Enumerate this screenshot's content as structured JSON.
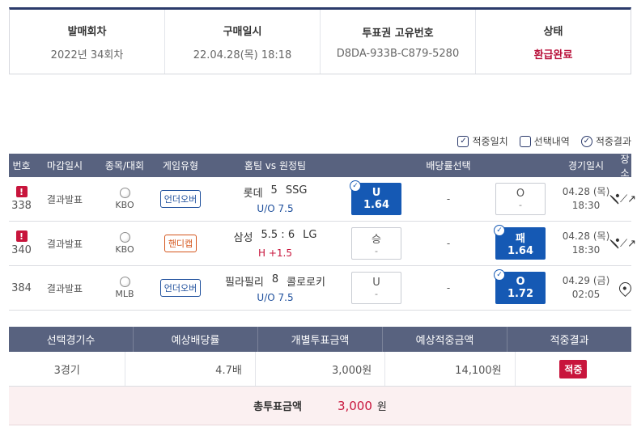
{
  "summary": {
    "round_label": "발매회차",
    "round_value": "2022년 34회차",
    "purchase_label": "구매일시",
    "purchase_value": "22.04.28(목) 18:18",
    "ticket_label": "투표권 고유번호",
    "ticket_value": "D8DA-933B-C879-5280",
    "status_label": "상태",
    "status_value": "환급완료"
  },
  "legend": {
    "hit_match": "적중일치",
    "selection": "선택내역",
    "hit_result": "적중결과"
  },
  "table_headers": [
    "번호",
    "마감일시",
    "종목/대회",
    "게임유형",
    "홈팀 vs 원정팀",
    "배당률선택",
    "경기일시",
    "장소"
  ],
  "games": [
    {
      "no": "338",
      "warning": "!",
      "close": "결과발표",
      "league": "KBO",
      "type": "언더오버",
      "type_color": "blue",
      "home": "롯데",
      "score": "5",
      "away": "SSG",
      "sub": "U/O 7.5",
      "sub_color": "blue",
      "opt1_label": "U",
      "opt1_odds": "1.64",
      "opt1_selected": true,
      "middle": "-",
      "opt2_label": "O",
      "opt2_odds": "-",
      "opt2_selected": false,
      "date": "04.28 (목)",
      "time": "18:30",
      "trend": true
    },
    {
      "no": "340",
      "warning": "!",
      "close": "결과발표",
      "league": "KBO",
      "type": "핸디캡",
      "type_color": "orange",
      "home": "삼성",
      "score": "5.5 : 6",
      "away": "LG",
      "sub": "H +1.5",
      "sub_color": "red",
      "opt1_label": "승",
      "opt1_odds": "-",
      "opt1_selected": false,
      "middle": "-",
      "opt2_label": "패",
      "opt2_odds": "1.64",
      "opt2_selected": true,
      "date": "04.28 (목)",
      "time": "18:30",
      "trend": true
    },
    {
      "no": "384",
      "warning": "",
      "close": "결과발표",
      "league": "MLB",
      "type": "언더오버",
      "type_color": "blue",
      "home": "필라필리",
      "score": "8",
      "away": "콜로로키",
      "sub": "U/O 7.5",
      "sub_color": "blue",
      "opt1_label": "U",
      "opt1_odds": "-",
      "opt1_selected": false,
      "middle": "-",
      "opt2_label": "O",
      "opt2_odds": "1.72",
      "opt2_selected": true,
      "date": "04.29 (금)",
      "time": "02:05",
      "trend": false
    }
  ],
  "totals": {
    "headers": [
      "선택경기수",
      "예상배당률",
      "개별투표금액",
      "예상적중금액",
      "적중결과"
    ],
    "count": "3경기",
    "odds": "4.7배",
    "bet": "3,000원",
    "expected": "14,100원",
    "result": "적중",
    "total_label": "총투표금액",
    "total_amount": "3,000",
    "total_unit": "원"
  },
  "colors": {
    "header_bg": "#58627f",
    "accent_red": "#c8153c",
    "accent_blue": "#1559b4",
    "navy": "#2b3a6b"
  }
}
